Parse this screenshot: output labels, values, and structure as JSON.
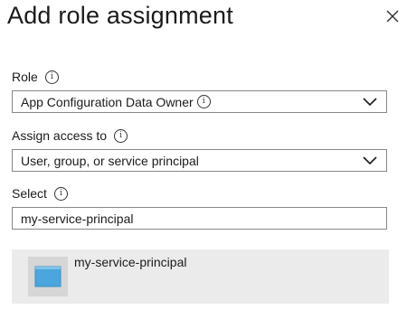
{
  "panel": {
    "title": "Add role assignment"
  },
  "role": {
    "label": "Role",
    "value": "App Configuration Data Owner"
  },
  "assign_access": {
    "label": "Assign access to",
    "value": "User, group, or service principal"
  },
  "select": {
    "label": "Select",
    "value": "my-service-principal"
  },
  "results": [
    {
      "name": "my-service-principal"
    }
  ],
  "icons": {
    "close": "close-icon",
    "info": "info-icon",
    "chevron": "chevron-down-icon",
    "app": "app-registration-icon"
  },
  "colors": {
    "result_background": "#ebebeb",
    "app_icon_blue": "#4aa6dd"
  }
}
